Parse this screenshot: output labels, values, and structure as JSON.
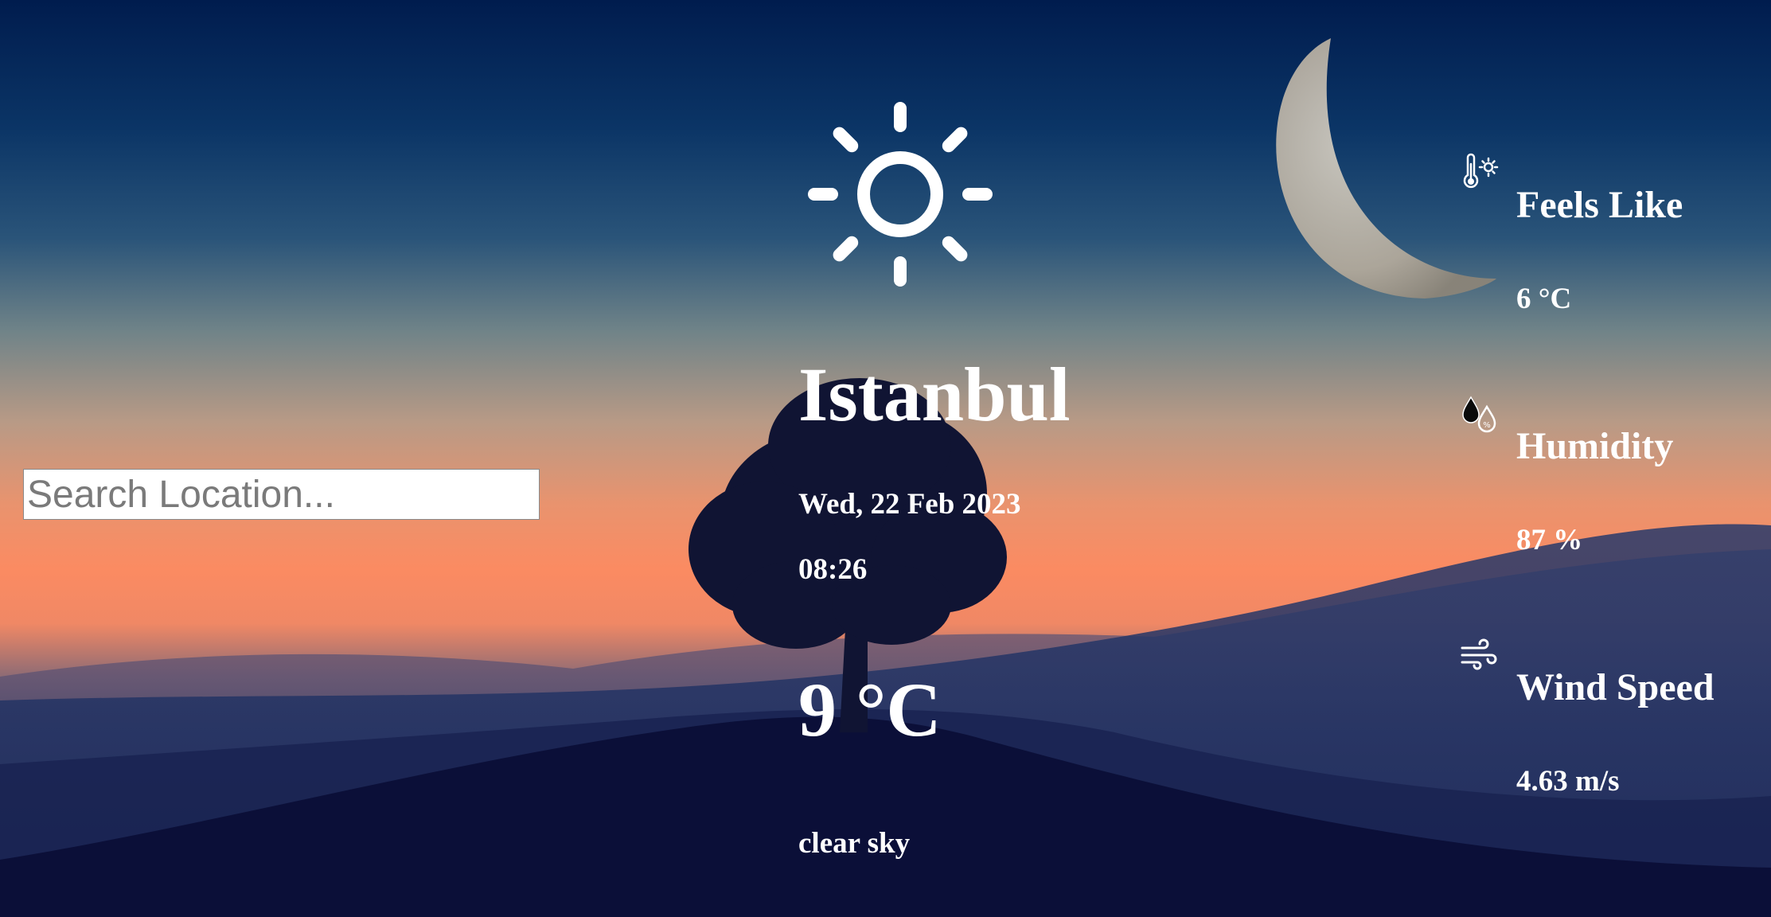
{
  "search": {
    "placeholder": "Search Location..."
  },
  "current": {
    "icon": "sun-icon",
    "city": "Istanbul",
    "date": "Wed, 22 Feb 2023",
    "time": "08:26",
    "temperature": "9 °C",
    "description": "clear sky"
  },
  "details": {
    "feels_like": {
      "icon": "thermometer-sun-icon",
      "label": "Feels Like",
      "value": "6 °C"
    },
    "humidity": {
      "icon": "humidity-drops-icon",
      "label": "Humidity",
      "value": "87 %"
    },
    "wind_speed": {
      "icon": "wind-icon",
      "label": "Wind Speed",
      "value": "4.63 m/s"
    }
  },
  "colors": {
    "text": "#ffffff",
    "sky_top": "#001c4e",
    "horizon": "#fb8b62",
    "ground": "#141b47"
  }
}
